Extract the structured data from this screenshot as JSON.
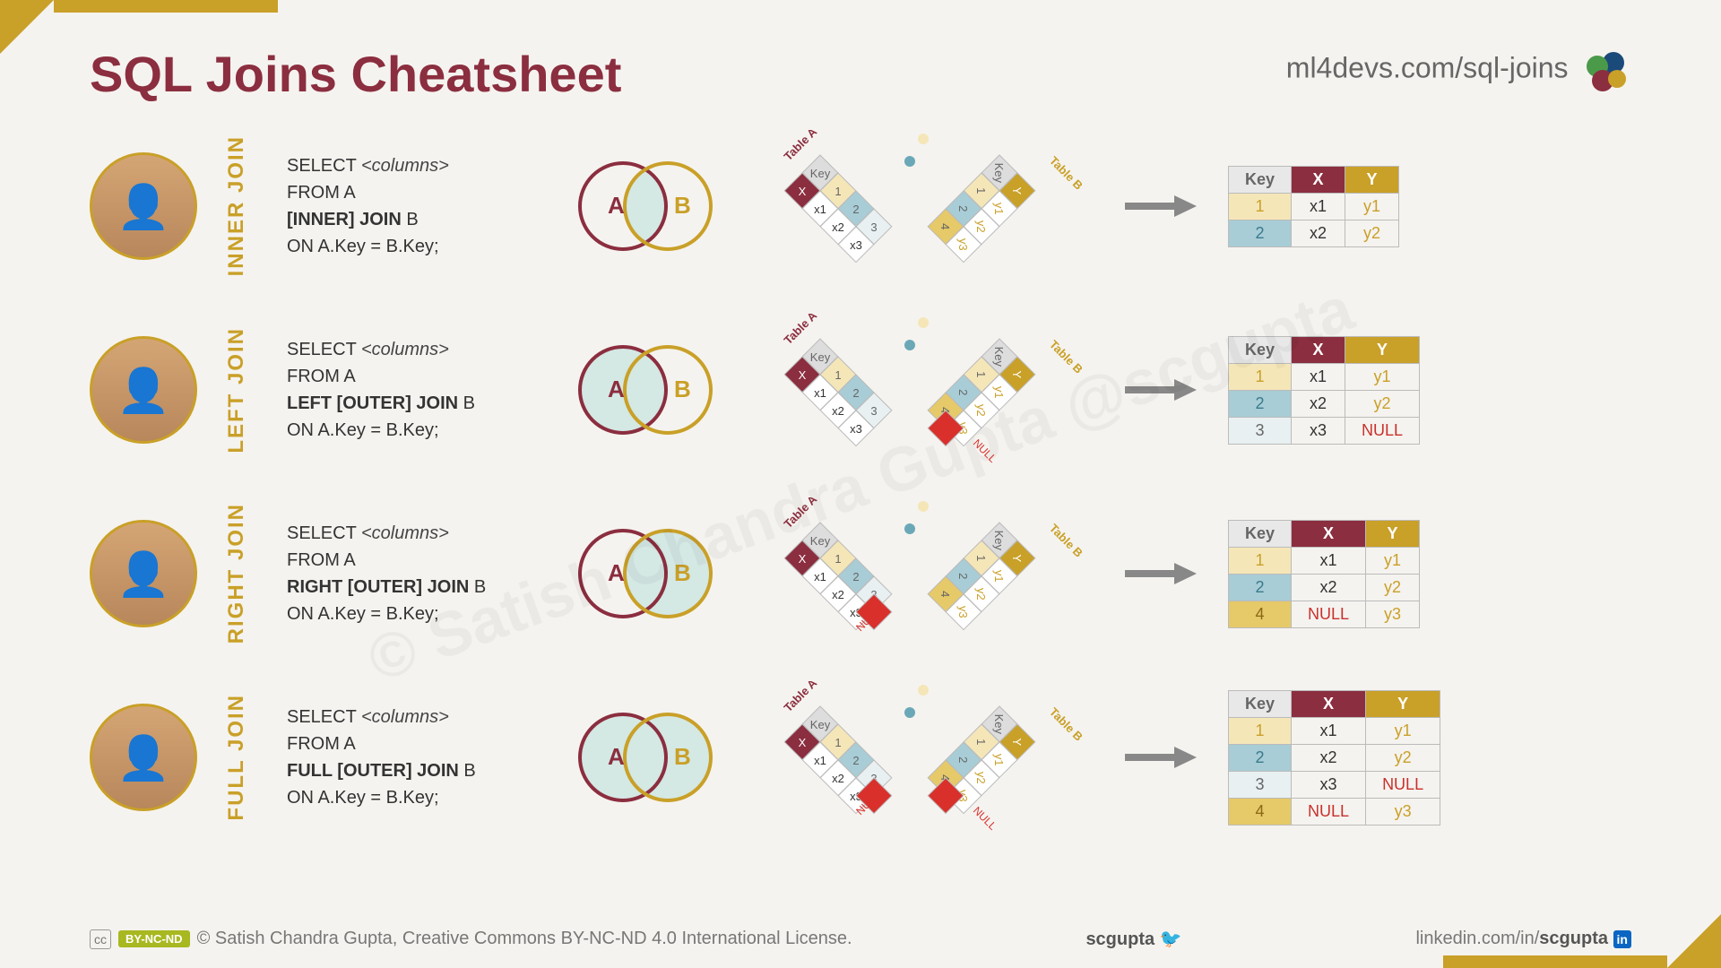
{
  "header": {
    "title": "SQL Joins Cheatsheet",
    "url": "ml4devs.com/sql-joins"
  },
  "watermark": "© Satish Chandra Gupta @scgupta",
  "joins": [
    {
      "label": "INNER JOIN",
      "sql": {
        "select": "SELECT ",
        "cols": "<columns>",
        "from": "FROM A",
        "join_bold": "[INNER] JOIN",
        "join_rest": " B",
        "on": "ON A.Key = B.Key;"
      },
      "venn": {
        "left": false,
        "mid": true,
        "right": false
      },
      "result": {
        "headers": [
          "Key",
          "X",
          "Y"
        ],
        "rows": [
          {
            "key": "1",
            "kclass": "kc1",
            "x": "x1",
            "y": "y1"
          },
          {
            "key": "2",
            "kclass": "kc2",
            "x": "x2",
            "y": "y2"
          }
        ]
      },
      "null_left": false,
      "null_right": false
    },
    {
      "label": "LEFT JOIN",
      "sql": {
        "select": "SELECT ",
        "cols": "<columns>",
        "from": "FROM A",
        "join_bold": "LEFT [OUTER] JOIN",
        "join_rest": " B",
        "on": "ON A.Key = B.Key;"
      },
      "venn": {
        "left": true,
        "mid": true,
        "right": false
      },
      "result": {
        "headers": [
          "Key",
          "X",
          "Y"
        ],
        "rows": [
          {
            "key": "1",
            "kclass": "kc1",
            "x": "x1",
            "y": "y1"
          },
          {
            "key": "2",
            "kclass": "kc2",
            "x": "x2",
            "y": "y2"
          },
          {
            "key": "3",
            "kclass": "kc3",
            "x": "x3",
            "y": "NULL",
            "ynull": true
          }
        ]
      },
      "null_left": false,
      "null_right": true
    },
    {
      "label": "RIGHT JOIN",
      "sql": {
        "select": "SELECT ",
        "cols": "<columns>",
        "from": "FROM A",
        "join_bold": "RIGHT [OUTER] JOIN",
        "join_rest": " B",
        "on": "ON A.Key = B.Key;"
      },
      "venn": {
        "left": false,
        "mid": true,
        "right": true
      },
      "result": {
        "headers": [
          "Key",
          "X",
          "Y"
        ],
        "rows": [
          {
            "key": "1",
            "kclass": "kc1",
            "x": "x1",
            "y": "y1"
          },
          {
            "key": "2",
            "kclass": "kc2",
            "x": "x2",
            "y": "y2"
          },
          {
            "key": "4",
            "kclass": "kc4",
            "x": "NULL",
            "xnull": true,
            "y": "y3"
          }
        ]
      },
      "null_left": true,
      "null_right": false
    },
    {
      "label": "FULL JOIN",
      "sql": {
        "select": "SELECT ",
        "cols": "<columns>",
        "from": "FROM A",
        "join_bold": "FULL [OUTER] JOIN",
        "join_rest": " B",
        "on": "ON A.Key = B.Key;"
      },
      "venn": {
        "left": true,
        "mid": true,
        "right": true
      },
      "result": {
        "headers": [
          "Key",
          "X",
          "Y"
        ],
        "rows": [
          {
            "key": "1",
            "kclass": "kc1",
            "x": "x1",
            "y": "y1"
          },
          {
            "key": "2",
            "kclass": "kc2",
            "x": "x2",
            "y": "y2"
          },
          {
            "key": "3",
            "kclass": "kc3",
            "x": "x3",
            "y": "NULL",
            "ynull": true
          },
          {
            "key": "4",
            "kclass": "kc4",
            "x": "NULL",
            "xnull": true,
            "y": "y3"
          }
        ]
      },
      "null_left": true,
      "null_right": true
    }
  ],
  "table_labels": {
    "a": "Table A",
    "b": "Table B",
    "key": "Key",
    "x": "X",
    "y": "Y",
    "xvals": [
      "x1",
      "x2",
      "x3"
    ],
    "yvals": [
      "y1",
      "y2",
      "y3"
    ],
    "akeys": [
      "1",
      "2",
      "3"
    ],
    "bkeys": [
      "1",
      "2",
      "4"
    ],
    "null": "NULL"
  },
  "footer": {
    "cc_badge": "BY-NC-ND",
    "copyright": "© Satish Chandra Gupta, Creative Commons BY-NC-ND 4.0 International License.",
    "handle": "scgupta",
    "linkedin_prefix": "linkedin.com/in/",
    "linkedin_handle": "scgupta"
  },
  "colors": {
    "maroon": "#8b2e3f",
    "gold": "#c9a028",
    "teal": "#a8cdd6",
    "grey": "#888"
  }
}
